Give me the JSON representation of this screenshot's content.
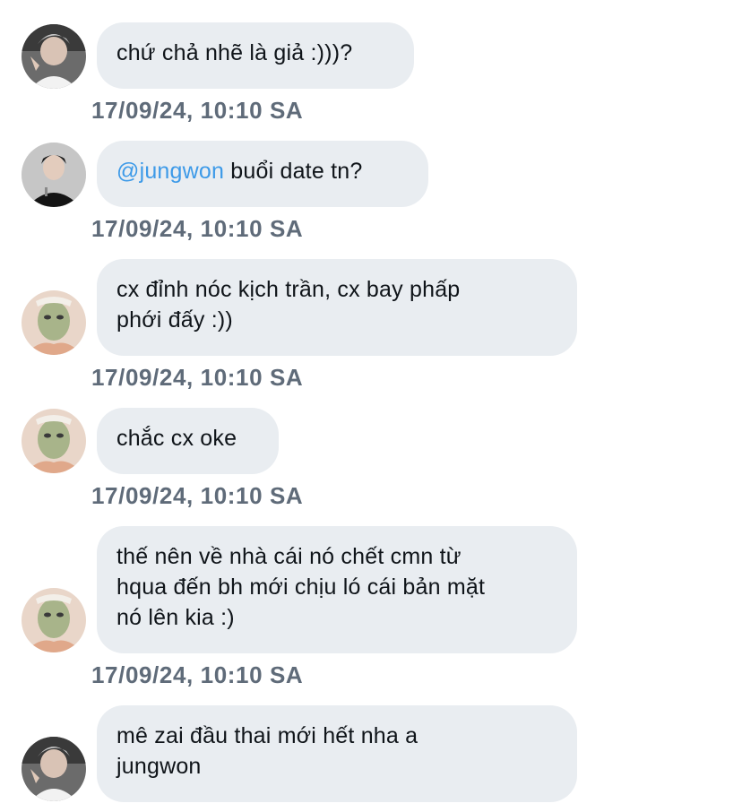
{
  "messages": [
    {
      "sender": "avatar-gray-hair",
      "text": "chứ chả nhẽ là giả :)))?",
      "timestamp": "17/09/24, 10:10 SA"
    },
    {
      "sender": "avatar-black-shirt",
      "mention": "@jungwon",
      "text": " buổi date tn?",
      "timestamp": "17/09/24, 10:10 SA"
    },
    {
      "sender": "avatar-face-mask",
      "line1": "cx đỉnh nóc kịch trần, cx bay phấp",
      "line2": "phới đấy :))",
      "timestamp": "17/09/24, 10:10 SA"
    },
    {
      "sender": "avatar-face-mask",
      "text": "chắc cx oke",
      "timestamp": "17/09/24, 10:10 SA"
    },
    {
      "sender": "avatar-face-mask",
      "line1": "thế nên về nhà cái nó chết cmn từ",
      "line2": "hqua đến bh mới chịu ló cái bản mặt",
      "line3": "nó lên kia :)",
      "timestamp": "17/09/24, 10:10 SA"
    },
    {
      "sender": "avatar-gray-hair",
      "line1": "mê zai đầu thai mới hết nha a",
      "line2": "jungwon"
    }
  ],
  "colors": {
    "bubble": "#e9edf1",
    "text": "#0f1419",
    "mention": "#3d9ae8",
    "timestamp": "#5f6b79"
  }
}
